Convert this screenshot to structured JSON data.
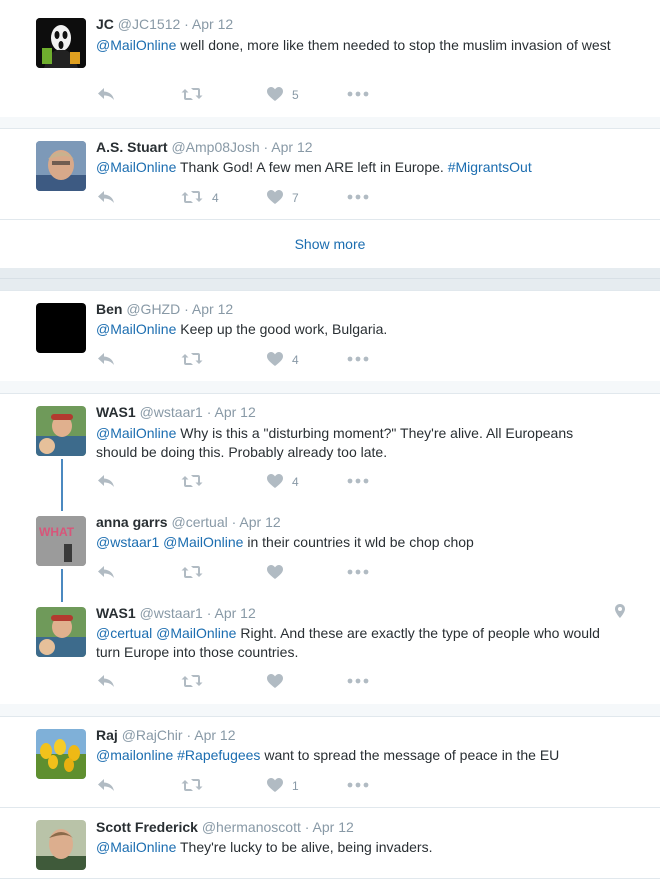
{
  "tweets": [
    {
      "name": "JC",
      "handle": "@JC1512",
      "date": "· Apr 12",
      "mention": "@MailOnline",
      "text": " well done, more like them needed to stop the muslim invasion of west",
      "retweets": "",
      "likes": "5"
    },
    {
      "name": "A.S. Stuart",
      "handle": "@Amp08Josh",
      "date": "· Apr 12",
      "mention": "@MailOnline",
      "text": " Thank God! A few men ARE left in Europe. ",
      "hashtag": "#MigrantsOut",
      "retweets": "4",
      "likes": "7"
    },
    {
      "name": "Ben",
      "handle": "@GHZD",
      "date": "· Apr 12",
      "mention": "@MailOnline",
      "text": " Keep up the good work, Bulgaria.",
      "retweets": "",
      "likes": "4"
    },
    {
      "name": "WAS1",
      "handle": "@wstaar1",
      "date": "· Apr 12",
      "mention": "@MailOnline",
      "text": "  Why is this a \"disturbing moment?\"  They're alive.  All Europeans should be doing this.  Probably already too late.",
      "retweets": "",
      "likes": "4"
    },
    {
      "name": "anna garrs",
      "handle": "@certual",
      "date": "· Apr 12",
      "mention": "@wstaar1 @MailOnline",
      "text": " in their countries it wld be chop chop",
      "retweets": "",
      "likes": ""
    },
    {
      "name": "WAS1",
      "handle": "@wstaar1",
      "date": "· Apr 12",
      "mention": "@certual @MailOnline",
      "text": "   Right.  And these are exactly the type of people who would turn Europe into those countries.",
      "retweets": "",
      "likes": ""
    },
    {
      "name": "Raj",
      "handle": "@RajChir",
      "date": "· Apr 12",
      "mention": "@mailonline",
      "hashtag": "#Rapefugees",
      "text": " want to spread the message of peace in the EU",
      "retweets": "",
      "likes": "1"
    },
    {
      "name": "Scott Frederick",
      "handle": "@hermanoscott",
      "date": "· Apr 12",
      "mention": "@MailOnline",
      "text": " They're lucky to be alive,  being invaders."
    }
  ],
  "show_more_label": "Show more",
  "avatar_text": {
    "anna": "WHAT"
  },
  "colors": {
    "link": "#1b6db0",
    "meta": "#8899a6",
    "thread": "#4b89c0",
    "background": "#e6ecf0"
  },
  "icons": [
    "reply-icon",
    "retweet-icon",
    "heart-icon",
    "more-icon",
    "location-pin-icon"
  ]
}
